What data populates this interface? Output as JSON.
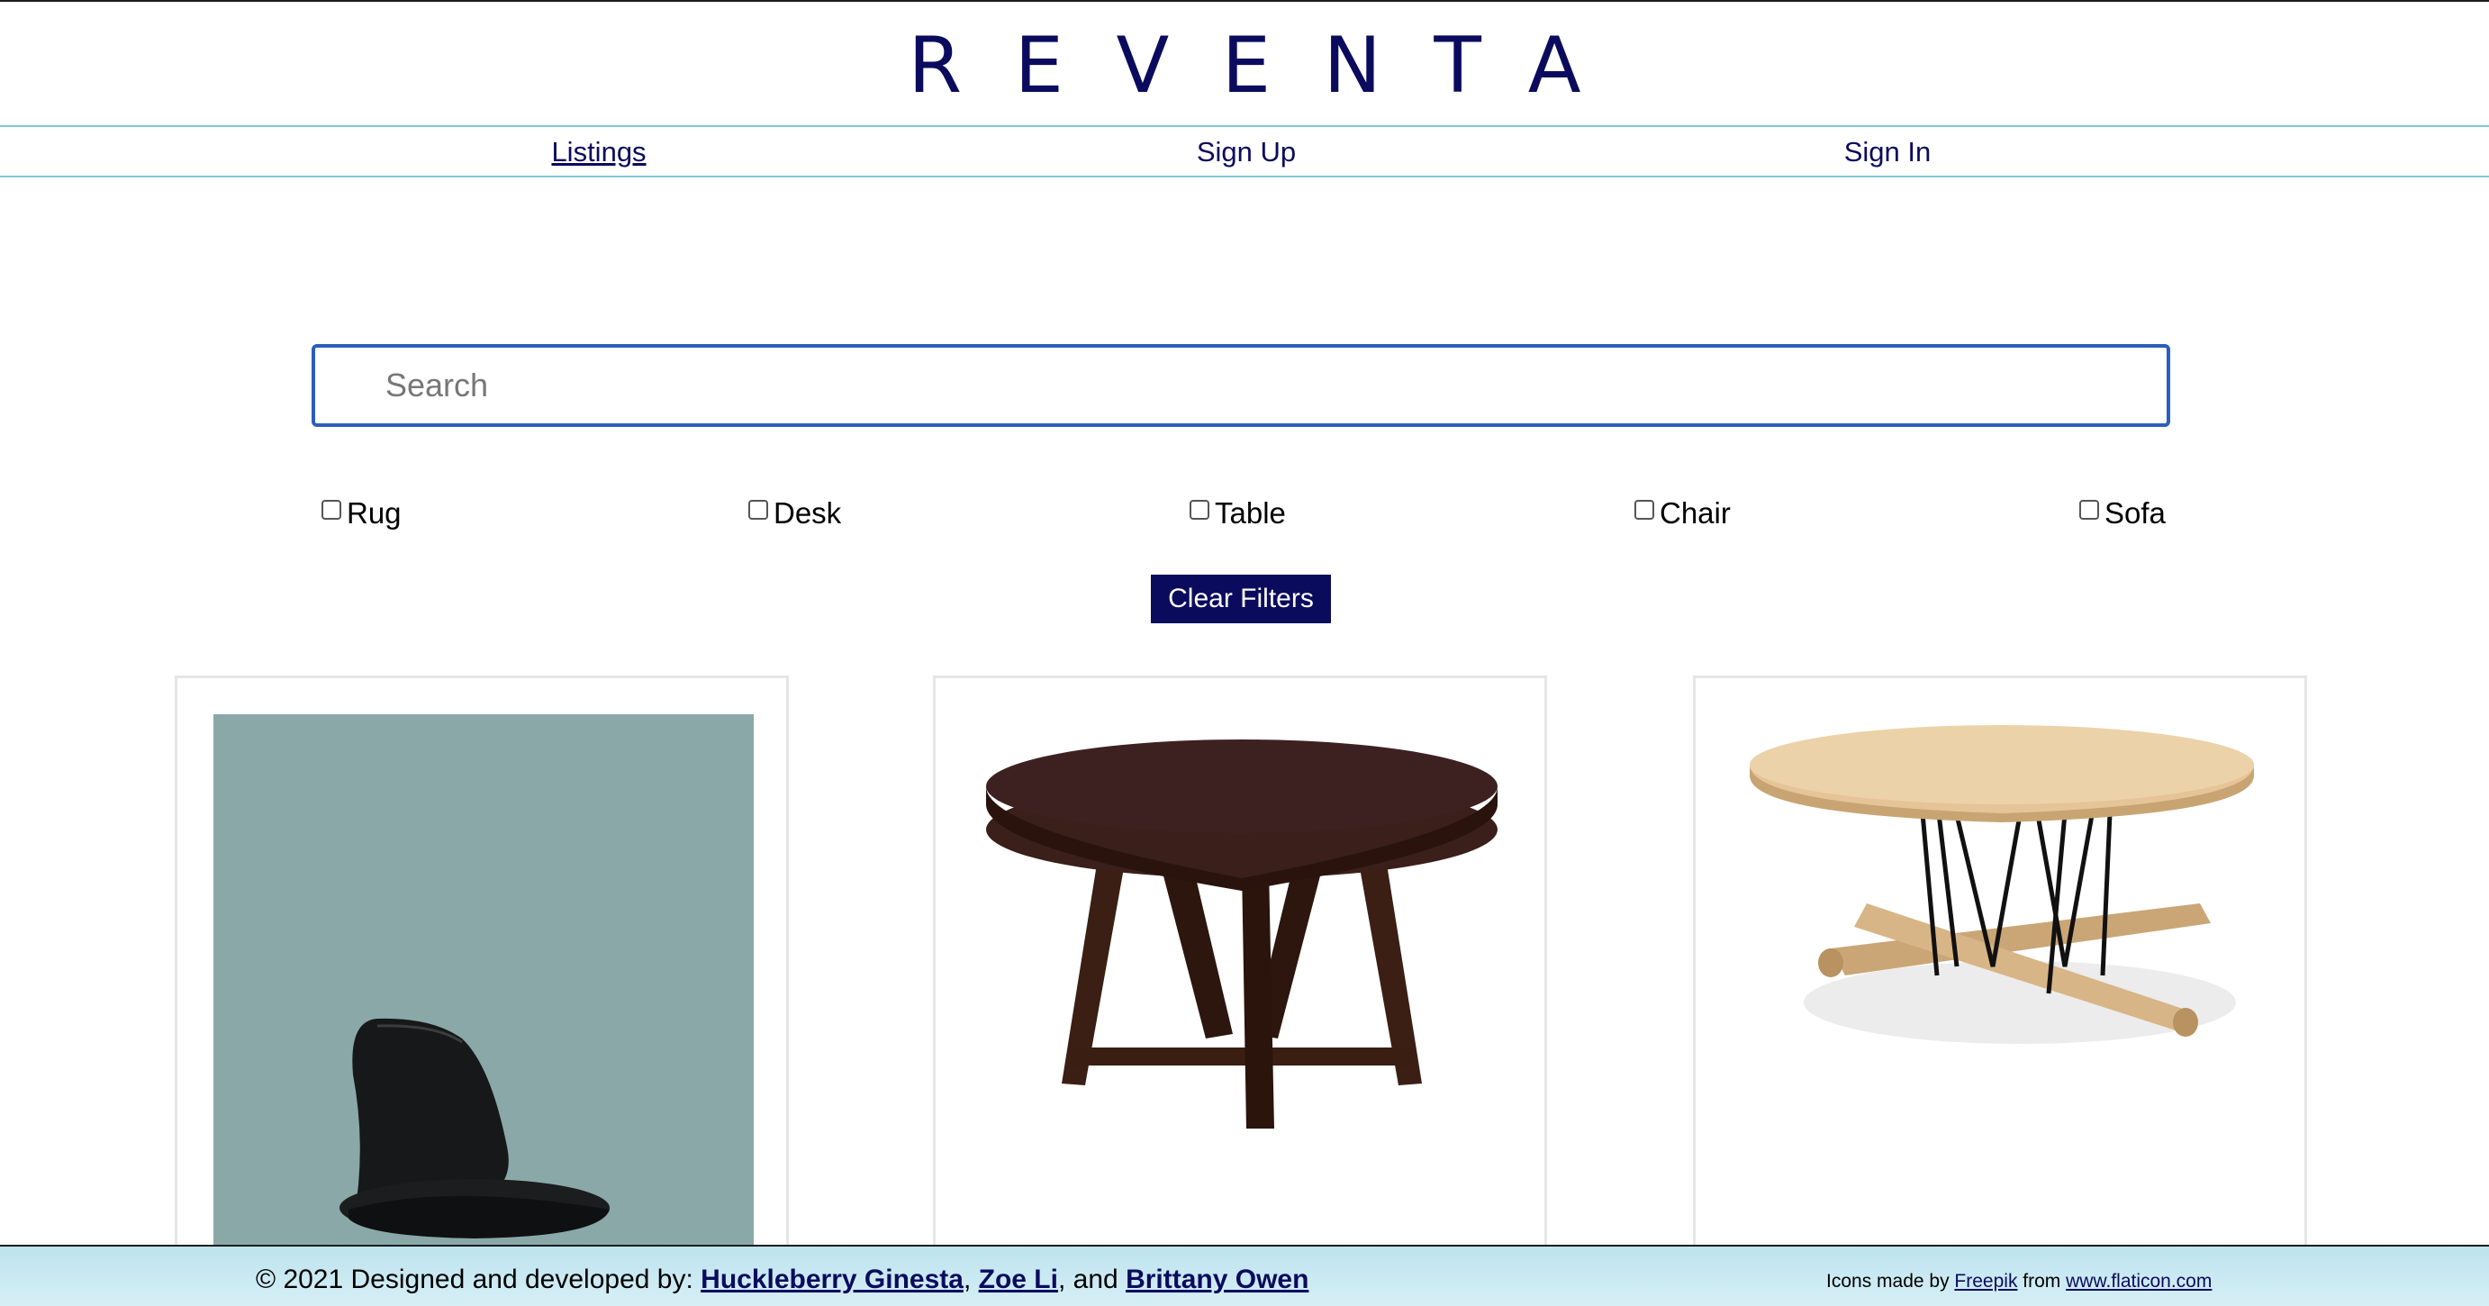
{
  "brand": {
    "title": "REVENTA"
  },
  "nav": {
    "items": [
      {
        "label": "Listings"
      },
      {
        "label": "Sign Up"
      },
      {
        "label": "Sign In"
      }
    ]
  },
  "search": {
    "placeholder": "Search",
    "value": ""
  },
  "filters": {
    "options": [
      {
        "label": "Rug",
        "checked": false
      },
      {
        "label": "Desk",
        "checked": false
      },
      {
        "label": "Table",
        "checked": false
      },
      {
        "label": "Chair",
        "checked": false
      },
      {
        "label": "Sofa",
        "checked": false
      }
    ],
    "clear_label": "Clear Filters"
  },
  "listings": [
    {
      "image": "black-chair-photo"
    },
    {
      "image": "dark-wood-round-table-photo"
    },
    {
      "image": "light-oak-coffee-table-photo"
    }
  ],
  "footer": {
    "copyright_prefix": "© 2021 Designed and developed by:",
    "authors": [
      "Huckleberry Ginesta",
      "Zoe Li",
      "Brittany Owen"
    ],
    "sep1": ",",
    "sep2": ", and",
    "icons_prefix": "Icons made by",
    "icons_author": "Freepik",
    "icons_from": "from",
    "icons_site": "www.flaticon.com"
  },
  "colors": {
    "brand": "#0b0b5e",
    "nav_rule": "#7fc6d9",
    "search_border": "#2a5fbd",
    "footer_bg": "#c8e8f1"
  }
}
